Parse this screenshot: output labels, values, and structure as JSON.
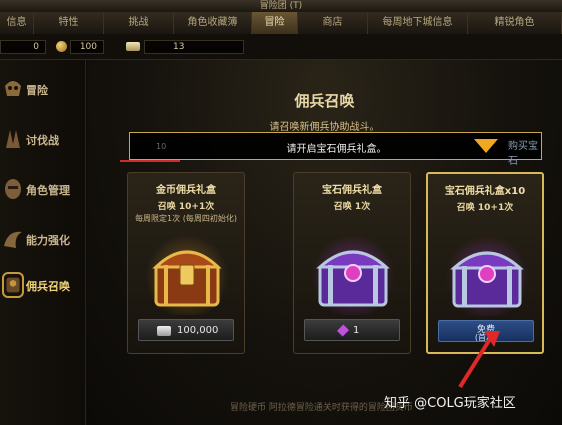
{
  "window": {
    "title": "冒险团 (T)"
  },
  "tabs": [
    {
      "label": "信息",
      "active": false
    },
    {
      "label": "特性",
      "active": false
    },
    {
      "label": "挑战",
      "active": false
    },
    {
      "label": "角色收藏簿",
      "active": false
    },
    {
      "label": "冒险",
      "active": true
    },
    {
      "label": "商店",
      "active": false
    },
    {
      "label": "每周地下城信息",
      "active": false
    },
    {
      "label": "精锐角色",
      "active": false
    }
  ],
  "currency": {
    "first": "0",
    "gold": "100",
    "bars": "13"
  },
  "sidebar": {
    "items": [
      {
        "label": "冒险",
        "icon": "skull-helmet-icon"
      },
      {
        "label": "讨伐战",
        "icon": "beast-claw-icon"
      },
      {
        "label": "角色管理",
        "icon": "warrior-face-icon"
      },
      {
        "label": "能力强化",
        "icon": "dragon-wing-icon"
      },
      {
        "label": "佣兵召唤",
        "icon": "mercenary-icon",
        "active": true
      }
    ]
  },
  "main": {
    "title": "佣兵召唤",
    "subtitle": "请召唤新佣兵协助战斗。"
  },
  "notice": {
    "text": "请开启宝石佣兵礼盒。",
    "number": "10",
    "button": "购买宝石"
  },
  "cards": [
    {
      "title": "金币佣兵礼盒",
      "sub": "召唤 10+1次",
      "note": "每周限定1次 (每周四初始化)",
      "price": "100,000",
      "price_icon": "silver-bars-icon",
      "chest_color": "gold"
    },
    {
      "title": "宝石佣兵礼盒",
      "sub": "召唤 1次",
      "note": "",
      "price": "1",
      "price_icon": "purple-gem-icon",
      "chest_color": "purple"
    },
    {
      "title": "宝石佣兵礼盒x10",
      "sub": "召唤 10+1次",
      "note": "",
      "free_line1": "免费",
      "free_line2": "(首次)",
      "chest_color": "purple",
      "selected": true
    }
  ],
  "footer": {
    "text": "冒险硬币  阿拉德冒险通关时获得的冒险团货币"
  },
  "watermark": {
    "text": "知乎 @COLG玩家社区"
  },
  "colors": {
    "accent": "#d8b858",
    "notice_arrow": "#f0a820",
    "highlight_red": "#d02a2a"
  }
}
